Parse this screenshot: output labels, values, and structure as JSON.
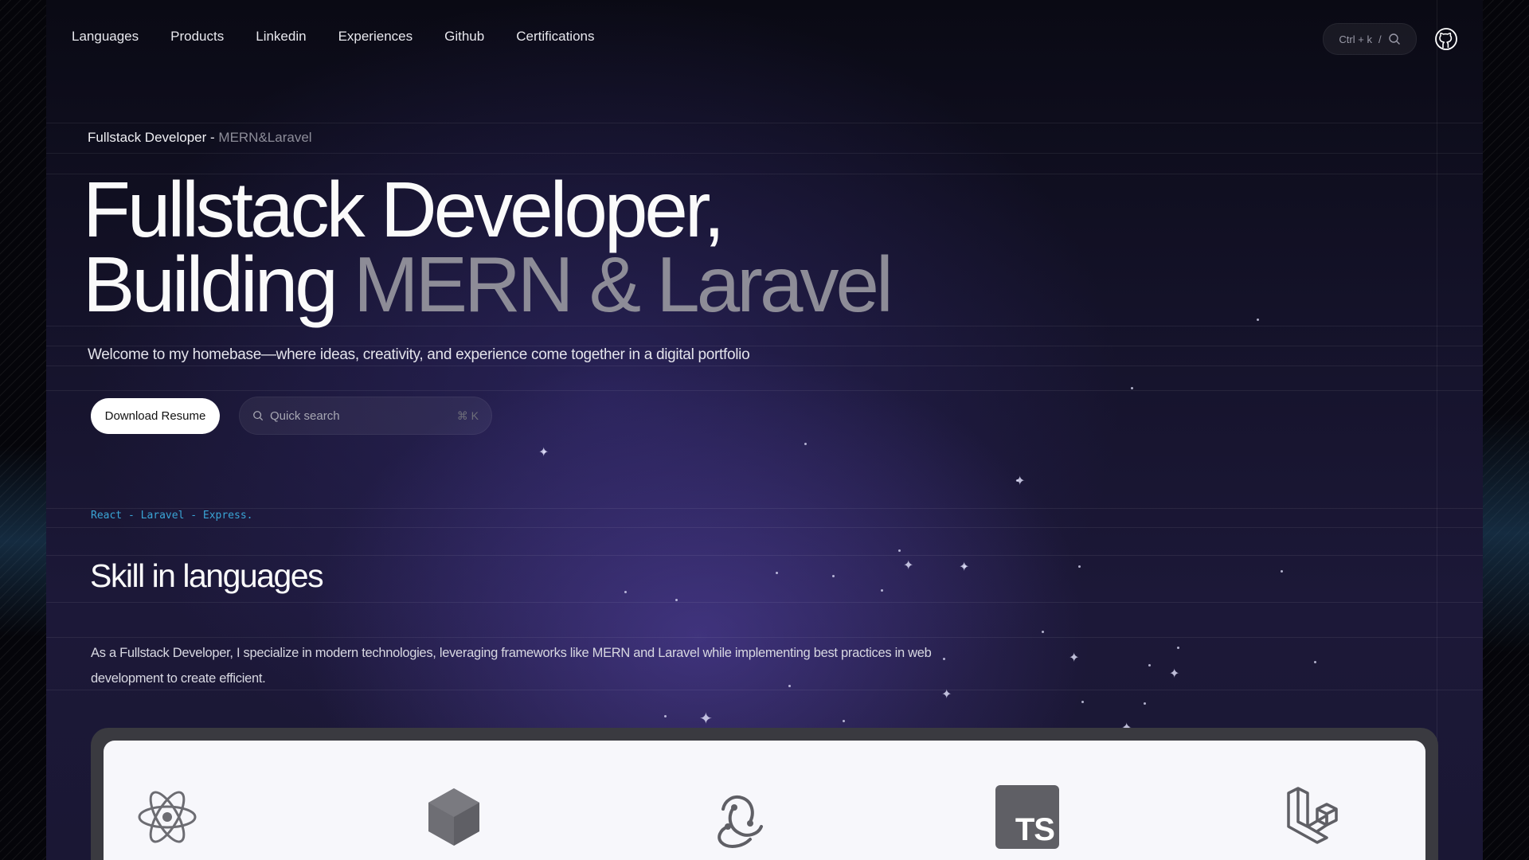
{
  "nav": {
    "items": [
      "Languages",
      "Products",
      "Linkedin",
      "Experiences",
      "Github",
      "Certifications"
    ]
  },
  "command": {
    "shortcut": "Ctrl + k",
    "separator": "/"
  },
  "breadcrumb": {
    "role": "Fullstack Developer -",
    "stack": "MERN&Laravel"
  },
  "hero": {
    "line1": "Fullstack Developer,",
    "line2_prefix": "Building",
    "line2_highlight": "MERN & Laravel"
  },
  "welcome": "Welcome to my homebase—where ideas, creativity, and experience come together in a digital portfolio",
  "actions": {
    "resume_label": "Download Resume",
    "search_placeholder": "Quick search",
    "search_shortcut": "⌘ K"
  },
  "skills": {
    "code_line": "React - Laravel - Express.",
    "title": "Skill in languages",
    "description": "As a Fullstack Developer, I specialize in modern technologies, leveraging frameworks like MERN and Laravel while implementing best practices in web development to create efficient."
  },
  "tech_icons": [
    "react-icon",
    "nodejs-icon",
    "redux-icon",
    "typescript-icon",
    "laravel-icon"
  ],
  "typescript_badge": "TS",
  "colors": {
    "background": "#07070d",
    "accent_code": "#3aa5d6",
    "muted_text": "#8d8c97",
    "panel": "#3a3a40"
  }
}
